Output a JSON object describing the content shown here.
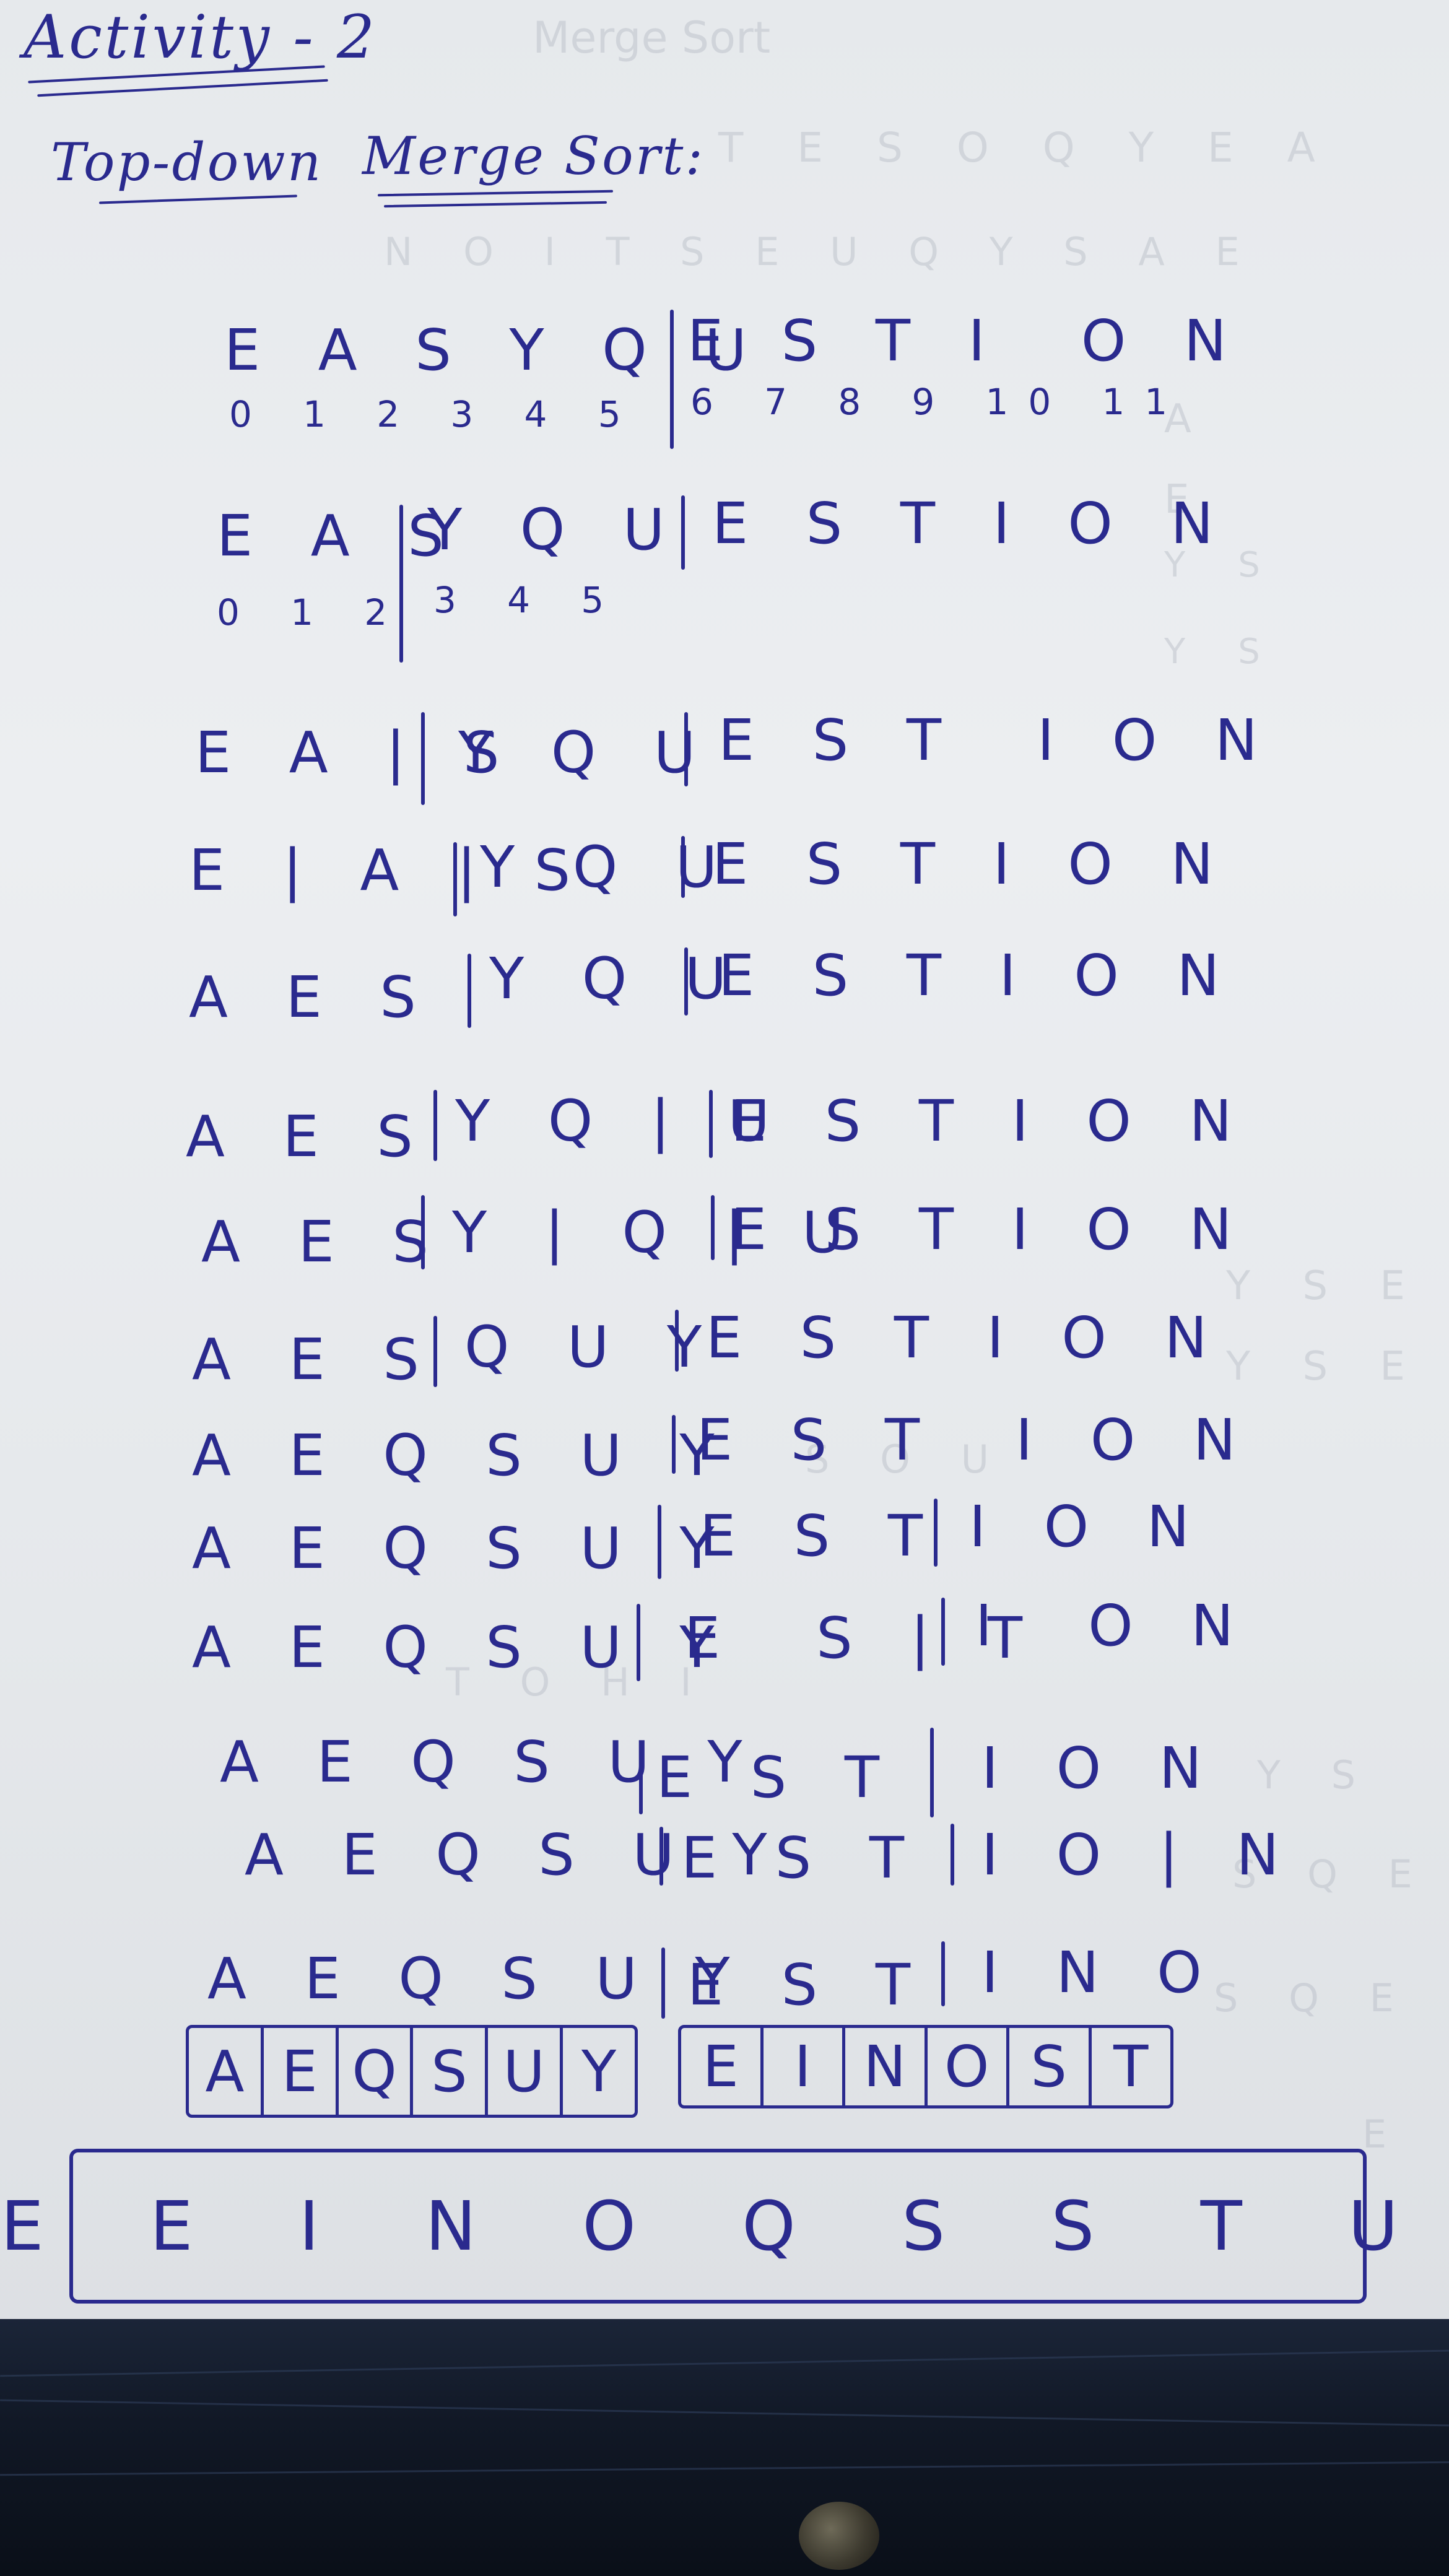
{
  "title": "Activity - 2",
  "heading": {
    "part1": "Top-down",
    "part2": "Merge Sort:"
  },
  "rows": [
    {
      "text": "E A S Y Q U"
    },
    {
      "text": "E S T I  O N"
    },
    {
      "text": "0 1 2 3 4 5"
    },
    {
      "text": "6 7 8 9 10 11"
    },
    {
      "text": "E A S"
    },
    {
      "text": "Y Q U"
    },
    {
      "text": "E S T I O N"
    },
    {
      "text": "0 1 2"
    },
    {
      "text": "3 4 5"
    },
    {
      "text": "E A | S"
    },
    {
      "text": "Y Q U"
    },
    {
      "text": "E S T  I O N"
    },
    {
      "text": "E | A | S"
    },
    {
      "text": "Y Q U"
    },
    {
      "text": "E S T I O N"
    },
    {
      "text": "A E S"
    },
    {
      "text": "Y Q U"
    },
    {
      "text": "E S T I O N"
    },
    {
      "text": "A E S"
    },
    {
      "text": "Y Q | U"
    },
    {
      "text": "E S T I O N"
    },
    {
      "text": "A E S"
    },
    {
      "text": "Y | Q | U"
    },
    {
      "text": "E S T I O N"
    },
    {
      "text": "A E S"
    },
    {
      "text": "Q U Y"
    },
    {
      "text": "E S T I O N"
    },
    {
      "text": "A E Q S U Y"
    },
    {
      "text": "E S T  I O N"
    },
    {
      "text": "A E Q S U Y"
    },
    {
      "text": "E S T"
    },
    {
      "text": "I O N"
    },
    {
      "text": "A E Q S U Y"
    },
    {
      "text": "E  S | T"
    },
    {
      "text": "I  O N"
    },
    {
      "text": "A E Q S U Y"
    },
    {
      "text": "E S T"
    },
    {
      "text": "I O N"
    },
    {
      "text": "A E Q S U Y"
    },
    {
      "text": "E S T"
    },
    {
      "text": "I O | N"
    },
    {
      "text": "A E Q S U Y"
    },
    {
      "text": "E S T"
    },
    {
      "text": "I N O"
    }
  ],
  "left_box": [
    "A",
    "E",
    "Q",
    "S",
    "U",
    "Y"
  ],
  "right_box": [
    "E",
    "I",
    "N",
    "O",
    "S",
    "T"
  ],
  "final": "A E E I N O Q S S T U Y"
}
